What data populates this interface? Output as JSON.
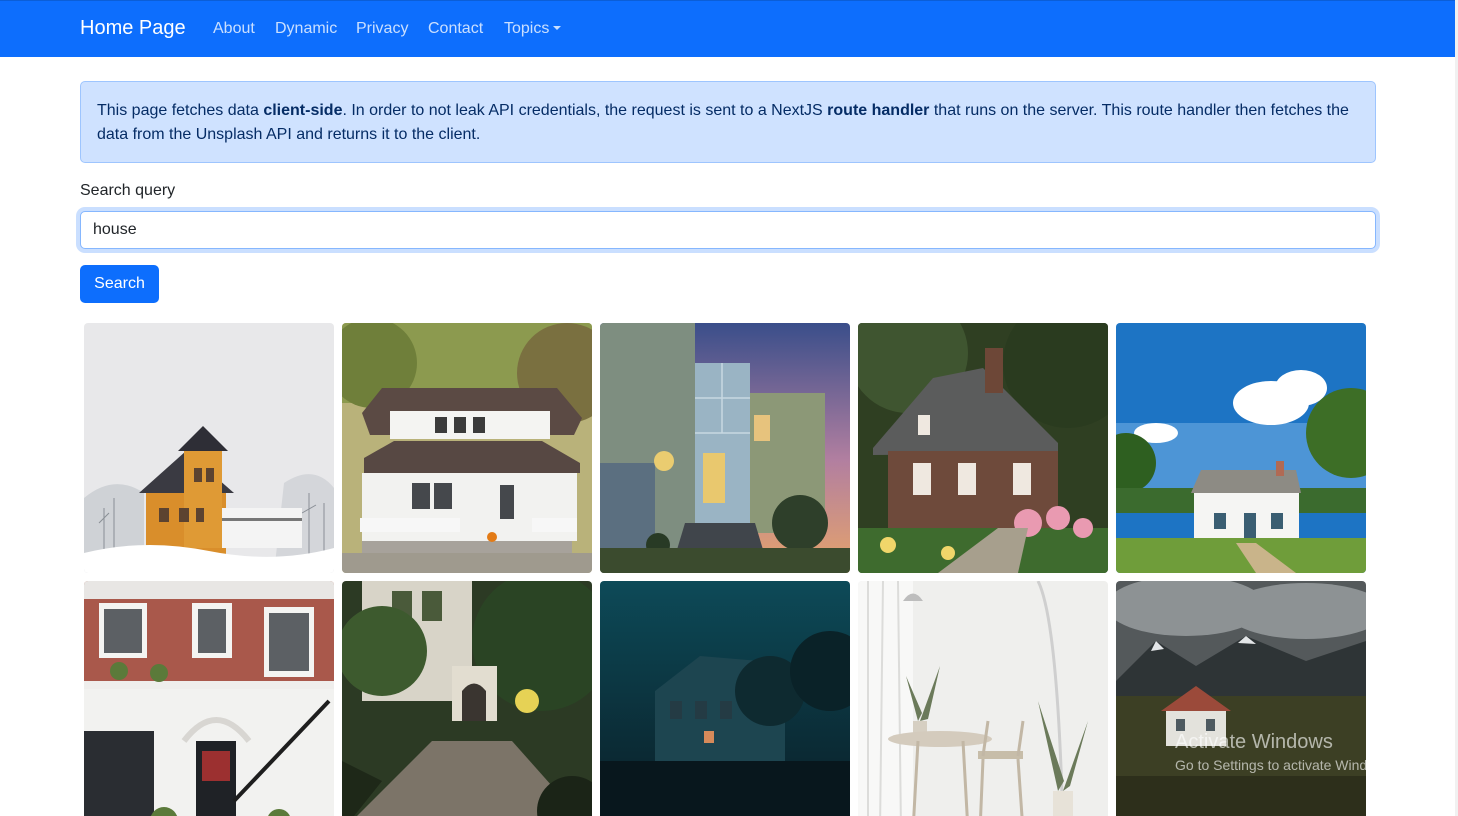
{
  "navbar": {
    "brand": "Home Page",
    "links": [
      "About",
      "Dynamic",
      "Privacy",
      "Contact",
      "Topics"
    ],
    "colors": {
      "background": "#0d6efd",
      "text": "#ffffff"
    }
  },
  "info_alert": {
    "text_1": "This page fetches data ",
    "bold_1": "client-side",
    "text_2": ". In order to not leak API credentials, the request is sent to a NextJS ",
    "bold_2": "route handler",
    "text_3": " that runs on the server. This route handler then fetches the data from the Unsplash API and returns it to the client."
  },
  "search": {
    "label": "Search query",
    "value": "house",
    "button_label": "Search"
  },
  "results": {
    "images": [
      "yellow-victorian-house-in-snow",
      "white-craftsman-house-with-porch",
      "modern-house-at-dusk",
      "brick-cottage-with-garden",
      "white-farmhouse-blue-sky",
      "red-brick-townhouse",
      "ivy-covered-house-driveway",
      "house-in-blue-fog",
      "white-interior-with-chairs",
      "farmhouse-under-mountains"
    ]
  },
  "os_watermark": {
    "title": "Activate Windows",
    "subtitle": "Go to Settings to activate Windows."
  }
}
